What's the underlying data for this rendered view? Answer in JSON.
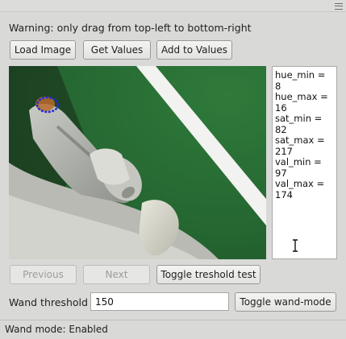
{
  "warning_text": "Warning: only drag from top-left to bottom-right",
  "toolbar": {
    "load_image": "Load Image",
    "get_values": "Get Values",
    "add_to_values": "Add to Values"
  },
  "values": [
    "hue_min = 8",
    "hue_max = 16",
    "sat_min = 82",
    "sat_max = 217",
    "val_min = 97",
    "val_max = 174"
  ],
  "nav": {
    "previous": "Previous",
    "next": "Next",
    "toggle_threshold_test": "Toggle treshold test"
  },
  "wand": {
    "label": "Wand threshold",
    "value": "150",
    "toggle_mode": "Toggle wand-mode"
  },
  "status": "Wand mode: Enabled",
  "colors": {
    "field": "#2a6a34",
    "line": "#f2f2f0",
    "selection_outline": "#1f2fd0"
  }
}
